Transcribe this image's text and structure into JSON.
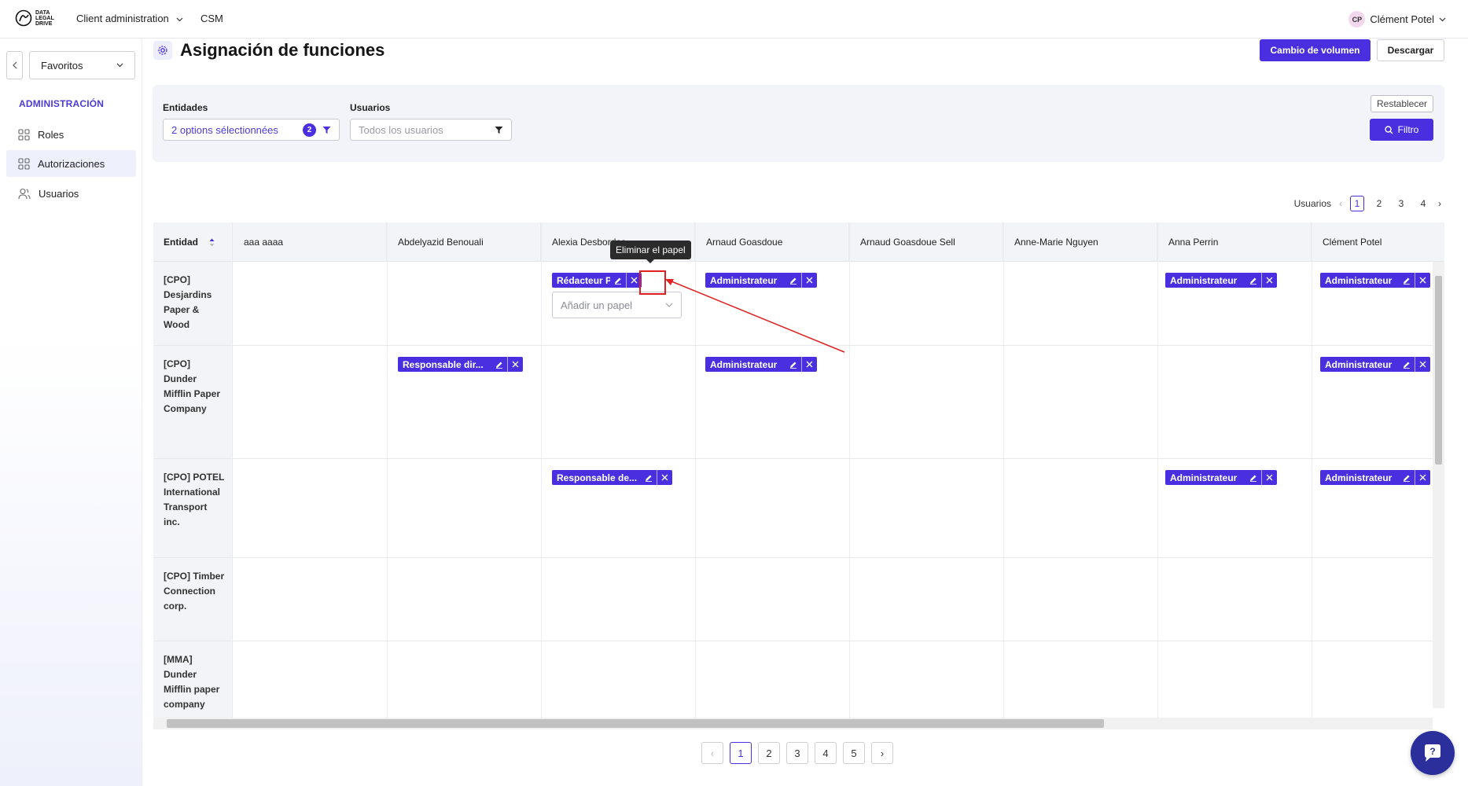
{
  "topbar": {
    "logo_text": "DATA LEGAL DRIVE",
    "client_admin_label": "Client administration",
    "csm_label": "CSM",
    "user_initials": "CP",
    "user_name": "Clément Potel"
  },
  "sidebar": {
    "favorites_label": "Favoritos",
    "section_title": "ADMINISTRACIÓN",
    "items": [
      {
        "label": "Roles",
        "icon": "grid-icon"
      },
      {
        "label": "Autorizaciones",
        "icon": "grid-icon",
        "active": true
      },
      {
        "label": "Usuarios",
        "icon": "users-icon"
      }
    ]
  },
  "header": {
    "title": "Asignación de funciones",
    "bulk_button": "Cambio de volumen",
    "download_button": "Descargar"
  },
  "filters": {
    "entities_label": "Entidades",
    "entities_value": "2 options sélectionnées",
    "entities_count": "2",
    "users_label": "Usuarios",
    "users_placeholder": "Todos los usuarios",
    "reset_button": "Restablecer",
    "filter_button": "Filtro"
  },
  "pager_top": {
    "label": "Usuarios",
    "pages": [
      "1",
      "2",
      "3",
      "4"
    ],
    "active": "1"
  },
  "table": {
    "entity_header": "Entidad",
    "columns": [
      "aaa aaaa",
      "Abdelyazid Benouali",
      "Alexia Desbordes",
      "Arnaud Goasdoue",
      "Arnaud Goasdoue Sell",
      "Anne-Marie Nguyen",
      "Anna Perrin",
      "Clément Potel"
    ],
    "rows": [
      {
        "entity": "[CPO] Desjardins Paper & Wood"
      },
      {
        "entity": "[CPO] Dunder Mifflin Paper Company"
      },
      {
        "entity": "[CPO] POTEL International Transport inc."
      },
      {
        "entity": "[CPO] Timber Connection corp."
      },
      {
        "entity": "[MMA] Dunder Mifflin paper company"
      }
    ],
    "roles": {
      "redacteur_pia": "Rédacteur PIA",
      "administrateur": "Administrateur",
      "responsable_dir": "Responsable dir...",
      "responsable_de": "Responsable de..."
    },
    "add_role_placeholder": "Añadir un papel"
  },
  "tooltip": {
    "text": "Eliminar el papel"
  },
  "pager_bottom": {
    "pages": [
      "1",
      "2",
      "3",
      "4",
      "5"
    ],
    "active": "1"
  },
  "colors": {
    "accent": "#4a2fe0",
    "annotation": "#e02020"
  }
}
